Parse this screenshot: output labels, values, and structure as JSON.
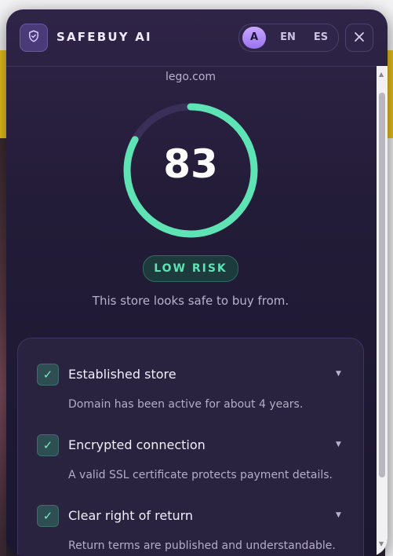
{
  "header": {
    "brand": "SAFEBUY AI",
    "languages": [
      "A",
      "EN",
      "ES"
    ],
    "active_language": "A"
  },
  "site": {
    "domain": "lego.com"
  },
  "score": {
    "value": "83",
    "fraction": 0.83,
    "risk_label": "LOW RISK",
    "summary": "This store looks safe to buy from."
  },
  "checks": [
    {
      "title": "Established store",
      "description": "Domain has been active for about 4 years."
    },
    {
      "title": "Encrypted connection",
      "description": "A valid SSL certificate protects payment details."
    },
    {
      "title": "Clear right of return",
      "description": "Return terms are published and understandable."
    }
  ],
  "colors": {
    "accent": "#5ee3b5",
    "popup_bg": "#231c38",
    "brand_purple": "#9a72f0"
  },
  "icons": [
    "shield-icon",
    "close-icon",
    "check-icon",
    "chevron-down-icon"
  ]
}
